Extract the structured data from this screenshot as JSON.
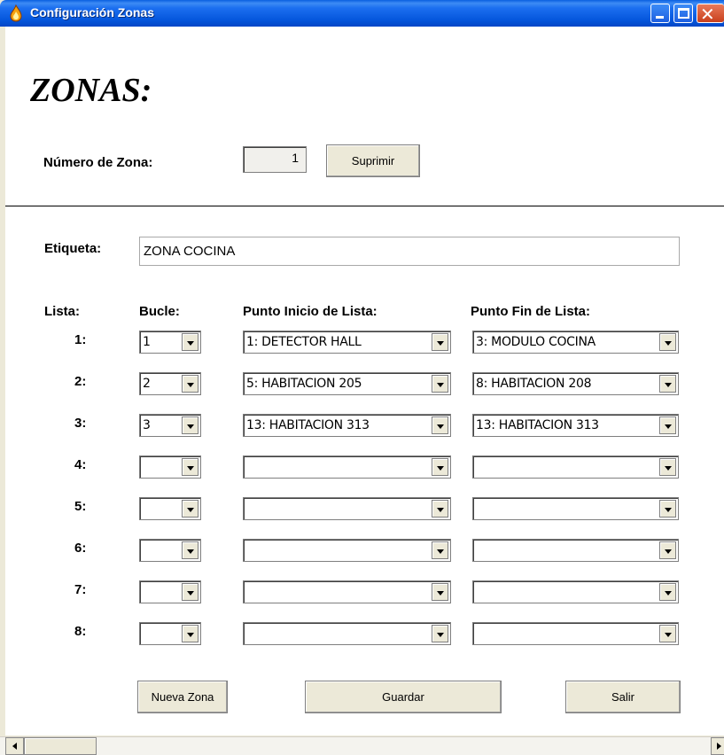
{
  "window": {
    "title": "Configuración Zonas"
  },
  "heading": "ZONAS:",
  "zone_number": {
    "label": "Número de Zona:",
    "value": "1",
    "delete_button": "Suprimir"
  },
  "tag": {
    "label": "Etiqueta:",
    "value": "ZONA COCINA"
  },
  "columns": {
    "list": "Lista:",
    "loop": "Bucle:",
    "start": "Punto Inicio de Lista:",
    "end": "Punto Fin de Lista:"
  },
  "rows": [
    {
      "num": "1:",
      "loop": "1",
      "start": "1: DETECTOR HALL",
      "end": "3: MODULO COCINA"
    },
    {
      "num": "2:",
      "loop": "2",
      "start": "5: HABITACION 205",
      "end": "8: HABITACION 208"
    },
    {
      "num": "3:",
      "loop": "3",
      "start": "13: HABITACION 313",
      "end": "13: HABITACION 313"
    },
    {
      "num": "4:",
      "loop": "",
      "start": "",
      "end": ""
    },
    {
      "num": "5:",
      "loop": "",
      "start": "",
      "end": ""
    },
    {
      "num": "6:",
      "loop": "",
      "start": "",
      "end": ""
    },
    {
      "num": "7:",
      "loop": "",
      "start": "",
      "end": ""
    },
    {
      "num": "8:",
      "loop": "",
      "start": "",
      "end": ""
    }
  ],
  "buttons": {
    "new_zone": "Nueva Zona",
    "save": "Guardar",
    "exit": "Salir"
  }
}
